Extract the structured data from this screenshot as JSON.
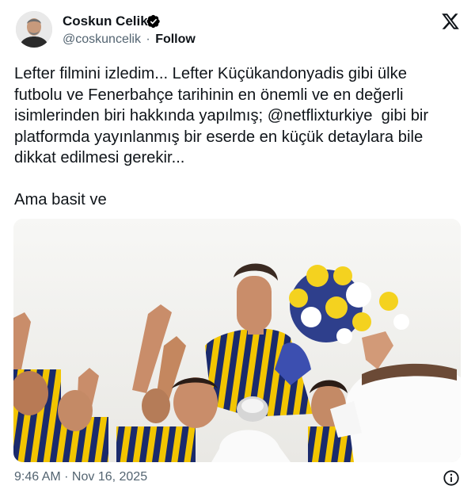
{
  "author": {
    "name": "Coskun Celik",
    "handle": "@coskuncelik",
    "separator": "·",
    "follow_label": "Follow"
  },
  "tweet": {
    "text": "Lefter filmini izledim... Lefter Küçükandonyadis gibi ülke futbolu ve Fenerbahçe tarihinin en önemli ve en değerli isimlerinden biri hakkında yapılmış; @netflixturkiye  gibi bir platformda yayınlanmış bir eserde en küçük detaylara bile dikkat edilmesi gerekir...\n\nAma basit ve",
    "timestamp": "9:46 AM · Nov 16, 2025"
  },
  "colors": {
    "verified_badge": "#000000",
    "secondary_text": "#536471",
    "jersey_yellow": "#f2c500",
    "jersey_navy": "#1a2a6c"
  },
  "icons": [
    "verified-badge-icon",
    "x-logo-icon",
    "info-icon"
  ]
}
